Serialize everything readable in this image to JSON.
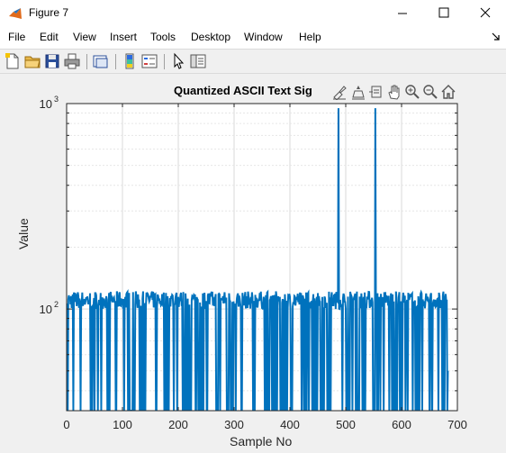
{
  "window": {
    "title": "Figure 7",
    "controls": [
      "minimize",
      "maximize",
      "close"
    ]
  },
  "menu": {
    "items": [
      "File",
      "Edit",
      "View",
      "Insert",
      "Tools",
      "Desktop",
      "Window",
      "Help"
    ]
  },
  "toolbar": {
    "icons": [
      "new-figure-icon",
      "open-file-icon",
      "save-icon",
      "print-icon",
      "link-plot-icon",
      "insert-colorbar-icon",
      "insert-legend-icon",
      "edit-plot-icon",
      "property-inspector-icon"
    ]
  },
  "axes_toolbar": {
    "icons": [
      "brush-icon",
      "data-tips-icon",
      "export-icon",
      "pan-icon",
      "zoom-in-icon",
      "zoom-out-icon",
      "home-icon"
    ]
  },
  "chart_data": {
    "type": "line",
    "title": "Quantized ASCII Text Sig",
    "xlabel": "Sample No",
    "ylabel": "Value",
    "xlim": [
      0,
      700
    ],
    "ylim": [
      32,
      1000
    ],
    "yscale": "log",
    "xticks": [
      0,
      100,
      200,
      300,
      400,
      500,
      600,
      700
    ],
    "xtick_labels": [
      "0",
      "100",
      "200",
      "300",
      "400",
      "500",
      "600",
      "700"
    ],
    "yticks": [
      100,
      1000
    ],
    "ytick_labels": [
      {
        "base": "10",
        "exp": "2"
      },
      {
        "base": "10",
        "exp": "3"
      }
    ],
    "grid": true,
    "line_color": "#0072BD",
    "series": [
      {
        "spikes": [
          {
            "x": 487,
            "y": 950
          },
          {
            "x": 553,
            "y": 950
          }
        ],
        "n_samples": 684,
        "typical_high_range": [
          100,
          122
        ],
        "typical_low": 32,
        "last_value": 50
      }
    ]
  }
}
